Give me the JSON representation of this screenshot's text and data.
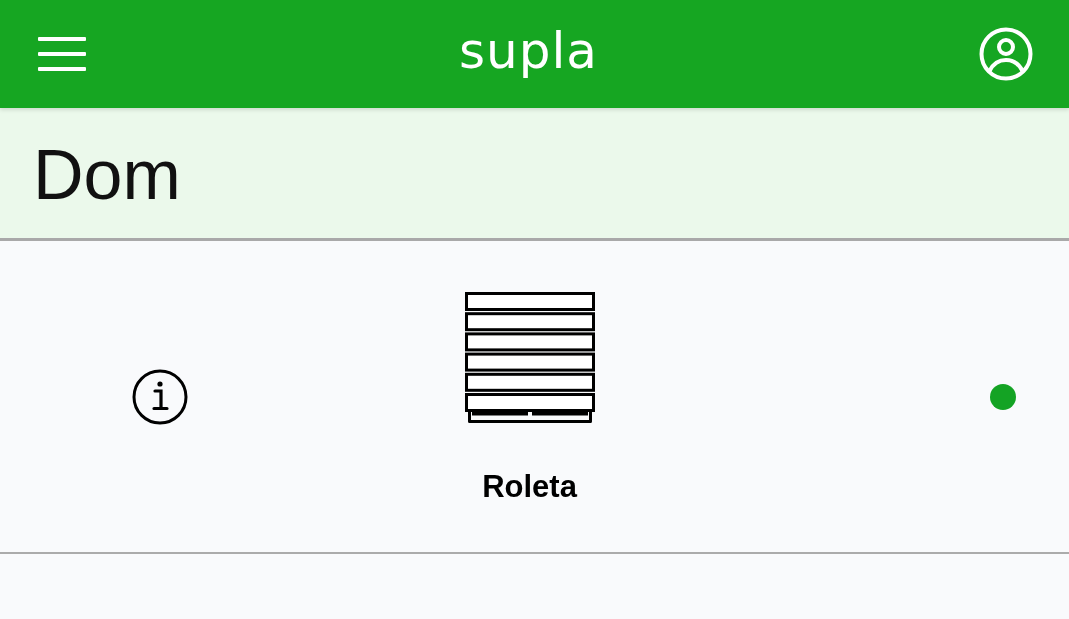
{
  "header": {
    "title": "supla"
  },
  "location": {
    "name": "Dom"
  },
  "channels": [
    {
      "kind": "roller-shutter",
      "name": "Roleta",
      "online": true
    }
  ]
}
